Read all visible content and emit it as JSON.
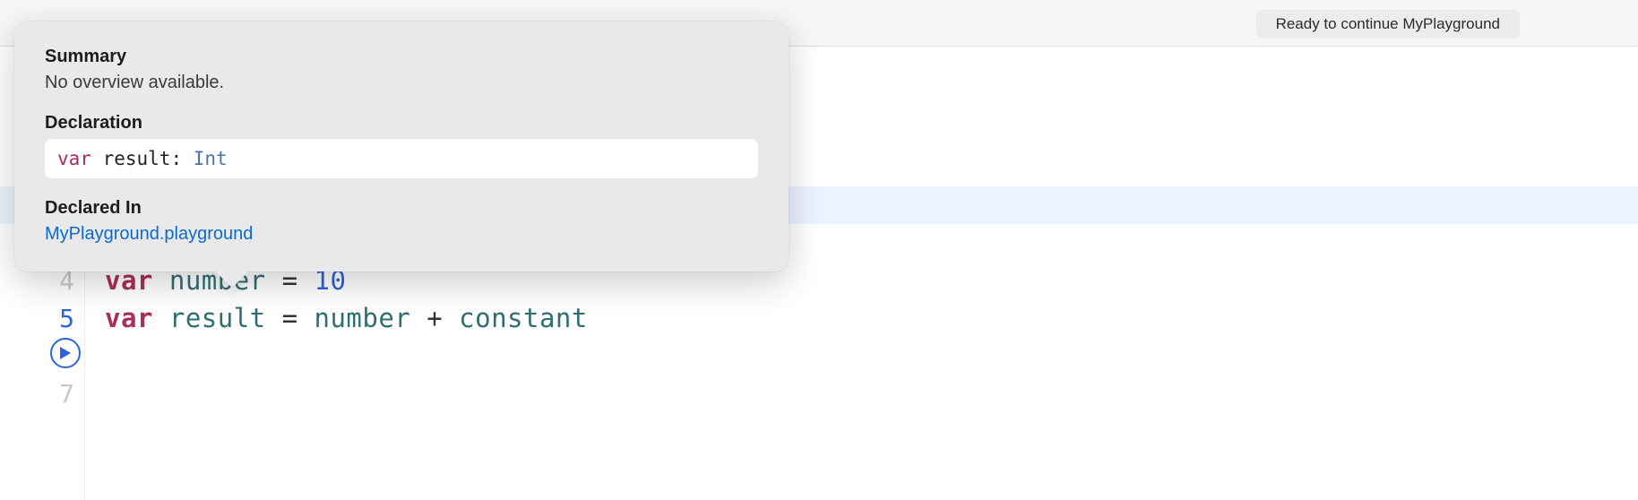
{
  "toolbar": {
    "status": "Ready to continue MyPlayground"
  },
  "editor": {
    "lines": {
      "l4": {
        "number": "4",
        "kw": "var",
        "id1": "number",
        "eq": " = ",
        "num": "10"
      },
      "l5": {
        "number": "5",
        "kw": "var",
        "id1": "result",
        "eq": " = ",
        "id2": "number",
        "plus": " + ",
        "id3": "constant"
      },
      "l7": {
        "number": "7"
      }
    }
  },
  "popover": {
    "summary_h": "Summary",
    "summary_body": "No overview available.",
    "decl_h": "Declaration",
    "decl_kw": "var",
    "decl_name": " result",
    "decl_colon": ": ",
    "decl_type": "Int",
    "declared_in_h": "Declared In",
    "declared_in_link": "MyPlayground.playground"
  }
}
